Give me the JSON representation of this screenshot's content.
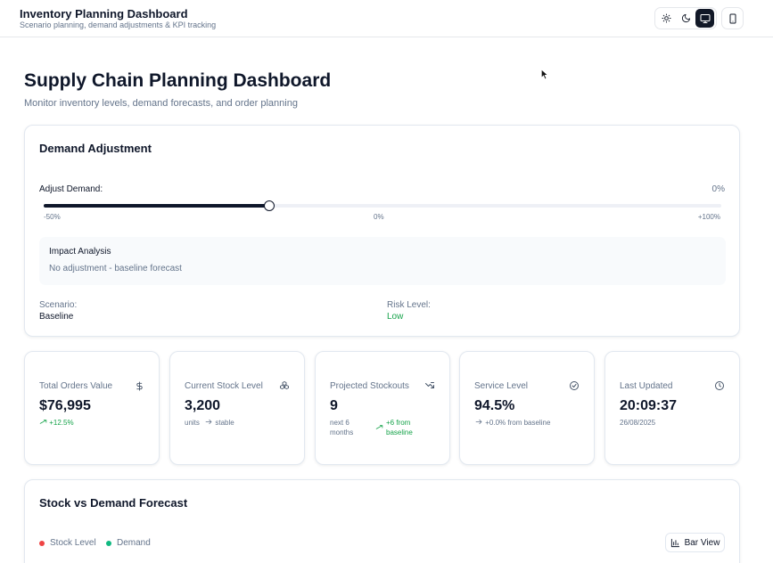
{
  "header": {
    "title": "Inventory Planning Dashboard",
    "subtitle": "Scenario planning, demand adjustments & KPI tracking",
    "theme_options": [
      "sun-icon",
      "moon-icon",
      "monitor-icon"
    ],
    "active_theme": "monitor",
    "device_icon": "smartphone-icon"
  },
  "page": {
    "title": "Supply Chain Planning Dashboard",
    "subtitle": "Monitor inventory levels, demand forecasts, and order planning"
  },
  "demand": {
    "title": "Demand Adjustment",
    "adjust_label": "Adjust Demand:",
    "adjust_value": "0%",
    "slider_level": 0.333,
    "ticks": [
      "-50%",
      "0%",
      "+100%"
    ],
    "impact_title": "Impact Analysis",
    "impact_text": "No adjustment - baseline forecast",
    "scenario_label": "Scenario:",
    "scenario_value": "Baseline",
    "risk_label": "Risk Level:",
    "risk_value": "Low"
  },
  "kpis": [
    {
      "label": "Total Orders Value",
      "icon": "dollar-icon",
      "value": "$76,995",
      "trend_icon": "trending-up-icon",
      "sub": "+12.5%"
    },
    {
      "label": "Current Stock Level",
      "icon": "boxes-icon",
      "value": "3,200",
      "sub_a": "units",
      "trend_icon": "arrow-right-icon",
      "sub_b": "stable"
    },
    {
      "label": "Projected Stockouts",
      "icon": "trend-arrows-icon",
      "value": "9",
      "sub_a": "next 6 months",
      "trend_icon": "trending-up-icon",
      "sub_b": "+6 from baseline"
    },
    {
      "label": "Service Level",
      "icon": "check-circle-icon",
      "value": "94.5%",
      "trend_icon": "arrow-right-icon",
      "sub": "+0.0% from baseline"
    },
    {
      "label": "Last Updated",
      "icon": "clock-icon",
      "value": "20:09:37",
      "sub": "26/08/2025"
    }
  ],
  "chart": {
    "title": "Stock vs Demand Forecast",
    "legend": [
      {
        "name": "Stock Level",
        "color": "#ef4444"
      },
      {
        "name": "Demand",
        "color": "#10b981"
      }
    ],
    "view_button": "Bar View",
    "view_icon": "bar-chart-icon"
  }
}
